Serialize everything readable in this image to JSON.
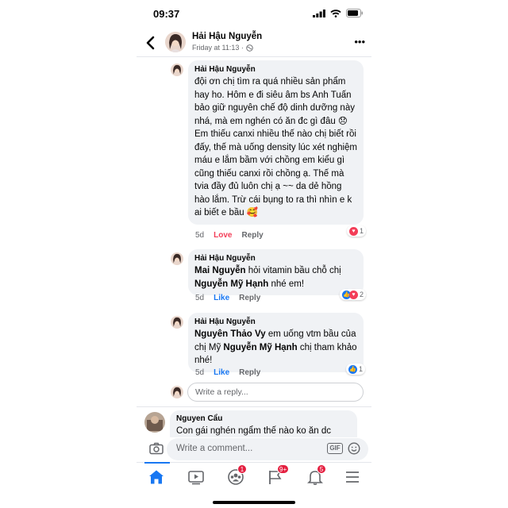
{
  "status_bar": {
    "time": "09:37"
  },
  "header": {
    "name": "Hải Hậu Nguyễn",
    "subtitle": "Friday at 11:13 ·",
    "more_icon": "more-icon",
    "back_icon": "back-chevron-icon"
  },
  "comments": [
    {
      "name": "Hải Hậu Nguyễn",
      "text": "đội ơn chị tìm ra quá nhiều sản phẩm hay ho. Hôm e đi siêu âm bs Anh Tuấn bảo giữ nguyên chế độ dinh dưỡng này nhá, mà em nghén có ăn đc gì đâu 😞 Em thiếu canxi nhiều thế nào chị biết rồi đấy, thế mà uống density lúc xét nghiệm máu e lắm bầm với chồng em kiểu gì cũng thiếu canxi rồi chồng ạ. Thế mà tvia đầy đủ luôn chị ạ ~~ da dẻ hồng hào lắm. Trừ cái bụng to ra thì nhìn e k ai biết e bầu 🥰",
      "time": "5d",
      "reaction_label": "Love",
      "reply_label": "Reply",
      "reaction_count": "1"
    },
    {
      "name": "Hải Hậu Nguyễn",
      "mention1": "Mai Nguyễn",
      "text1": " hỏi vitamin bầu chỗ chị",
      "mention2": "Nguyễn Mỹ Hạnh",
      "text2": " nhé em!",
      "time": "5d",
      "reaction_label": "Like",
      "reply_label": "Reply",
      "reaction_count": "2"
    },
    {
      "name": "Hải Hậu Nguyễn",
      "mention1": "Nguyên Thảo Vy",
      "text1": " em uống vtm bầu của chị Mỹ ",
      "mention2": "Nguyễn Mỹ Hạnh",
      "text2": " chị tham khảo nhé!",
      "time": "5d",
      "reaction_label": "Like",
      "reply_label": "Reply",
      "reaction_count": "1"
    }
  ],
  "reply_box": {
    "placeholder": "Write a reply..."
  },
  "next_comment": {
    "name": "Nguyen Cẩu",
    "text": "Con gái nghén ngẩm thế nào ko ăn dc"
  },
  "comment_bar": {
    "placeholder": "Write a comment...",
    "gif_label": "GIF"
  },
  "tabbar": {
    "badges": {
      "groups": "1",
      "pages": "9+",
      "notifications": "5"
    }
  },
  "colors": {
    "accent": "#1877f2",
    "love": "#f33e58",
    "badge": "#e41e3f",
    "bubble": "#f0f2f5"
  }
}
